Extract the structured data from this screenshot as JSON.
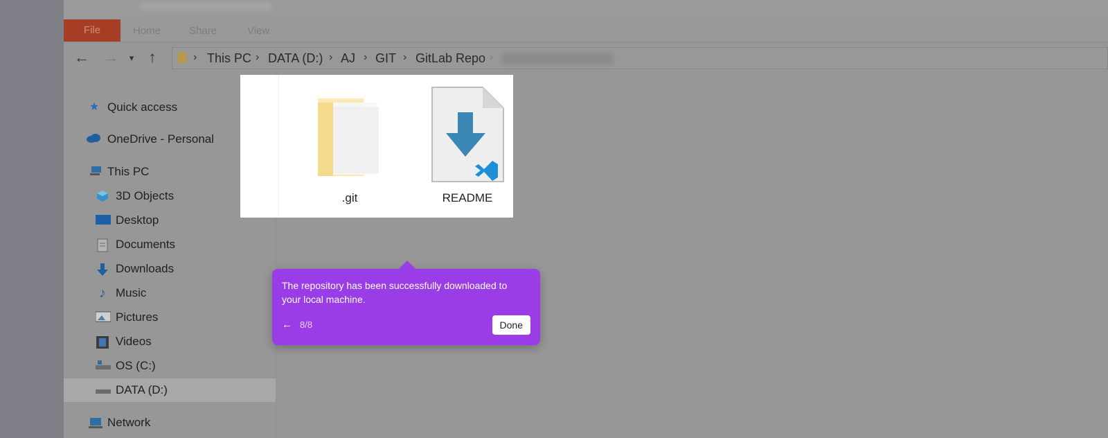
{
  "ribbon": {
    "tabs": [
      "File",
      "Home",
      "Share",
      "View"
    ]
  },
  "address_bar": {
    "crumbs": [
      "This PC",
      "DATA (D:)",
      "AJ",
      "GIT",
      "GitLab Repo"
    ]
  },
  "sidebar": {
    "items": [
      {
        "label": "Quick access",
        "icon": "star-icon"
      },
      {
        "label": "OneDrive - Personal",
        "icon": "cloud-icon"
      },
      {
        "label": "This PC",
        "icon": "computer-icon"
      },
      {
        "label": "3D Objects",
        "icon": "cube-icon"
      },
      {
        "label": "Desktop",
        "icon": "desktop-icon"
      },
      {
        "label": "Documents",
        "icon": "document-icon"
      },
      {
        "label": "Downloads",
        "icon": "download-icon"
      },
      {
        "label": "Music",
        "icon": "music-icon"
      },
      {
        "label": "Pictures",
        "icon": "picture-icon"
      },
      {
        "label": "Videos",
        "icon": "video-icon"
      },
      {
        "label": "OS (C:)",
        "icon": "drive-icon"
      },
      {
        "label": "DATA (D:)",
        "icon": "drive-icon",
        "selected": true
      },
      {
        "label": "Network",
        "icon": "network-icon"
      }
    ]
  },
  "files": [
    {
      "name": ".git",
      "icon": "folder-icon"
    },
    {
      "name": "README",
      "icon": "vscode-file-icon"
    }
  ],
  "tooltip": {
    "message": "The repository has been successfully downloaded to your local machine.",
    "step": "8/8",
    "done_label": "Done",
    "accent": "#9b3de6"
  }
}
